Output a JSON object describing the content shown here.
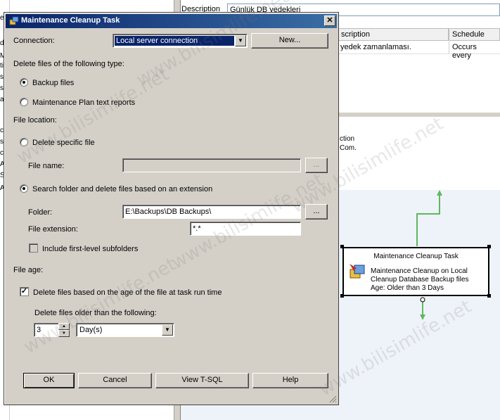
{
  "background": {
    "description_label": "Description",
    "description_value": "Günlük DB yedekleri",
    "grid": {
      "col1_header": "scription",
      "col2_header": "Schedule",
      "col1_cell": "yedek zamanlaması.",
      "col2_cell": "Occurs every"
    },
    "stub_lines": [
      "ction",
      "Com."
    ],
    "left_fragments": [
      "ec",
      "d",
      "M",
      "ti",
      "s",
      "s",
      "al",
      "c",
      "se",
      "c",
      "A",
      "S",
      "A"
    ],
    "task_box": {
      "title": "Maintenance Cleanup Task",
      "line1": "Maintenance Cleanup on Local",
      "line2": "Cleanup Database Backup files",
      "line3": "Age: Older than 3 Days"
    }
  },
  "dialog": {
    "title": "Maintenance Cleanup Task",
    "close_glyph": "✕",
    "connection_label": "Connection:",
    "connection_value": "Local server connection",
    "new_button": "New...",
    "delete_type_label": "Delete files of the following type:",
    "radio_backup_files": "Backup files",
    "radio_text_reports": "Maintenance Plan text reports",
    "file_location_label": "File location:",
    "radio_delete_specific": "Delete specific file",
    "file_name_label": "File name:",
    "file_name_value": "",
    "browse_glyph": "...",
    "radio_search_folder": "Search folder and delete files based on an extension",
    "folder_label": "Folder:",
    "folder_value": "E:\\Backups\\DB Backups\\",
    "extension_label": "File extension:",
    "extension_value": "*.*",
    "include_subfolders": "Include first-level subfolders",
    "file_age_label": "File age:",
    "age_checkbox_label": "Delete files based on the age of the file at task run time",
    "age_checkmark": "✓",
    "older_than_label": "Delete files older than the following:",
    "age_number": "3",
    "age_unit": "Day(s)",
    "ok_button": "OK",
    "cancel_button": "Cancel",
    "tsql_button": "View T-SQL",
    "help_button": "Help"
  },
  "watermark_text": "www.bilisimlife.net",
  "colors": {
    "dialog_face": "#d4d0c8",
    "titlebar_start": "#0a246a",
    "titlebar_end": "#3a6ea5",
    "selection": "#0a246a",
    "connector_green": "#5fb85f"
  }
}
